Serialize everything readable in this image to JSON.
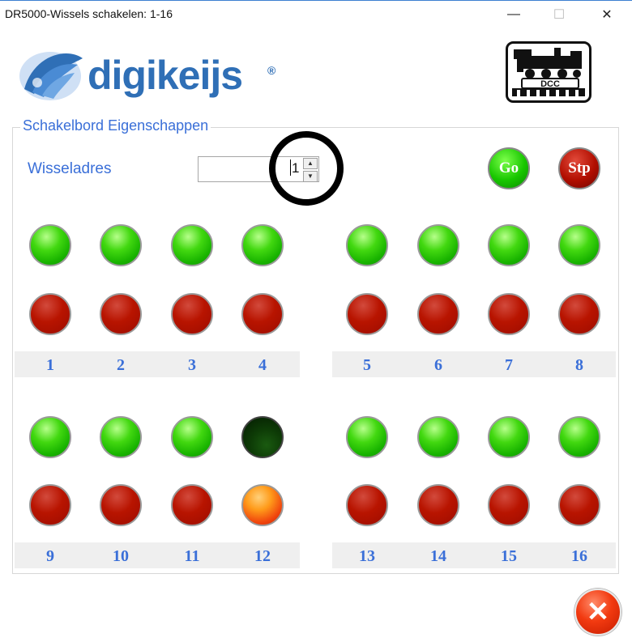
{
  "window": {
    "title": "DR5000-Wissels schakelen: 1-16",
    "minimize": "—",
    "maximize": "☐",
    "close": "✕"
  },
  "logo": {
    "text": "digikeijs",
    "reg": "®",
    "dcc_label": "DCC"
  },
  "panel": {
    "title": "Schakelbord Eigenschappen",
    "address_label": "Wisseladres",
    "address_value": "1",
    "go_label": "Go",
    "stop_label": "Stp"
  },
  "switches": [
    {
      "number": "1",
      "green": "normal",
      "red": "normal"
    },
    {
      "number": "2",
      "green": "normal",
      "red": "normal"
    },
    {
      "number": "3",
      "green": "normal",
      "red": "normal"
    },
    {
      "number": "4",
      "green": "normal",
      "red": "normal"
    },
    {
      "number": "5",
      "green": "normal",
      "red": "normal"
    },
    {
      "number": "6",
      "green": "normal",
      "red": "normal"
    },
    {
      "number": "7",
      "green": "normal",
      "red": "normal"
    },
    {
      "number": "8",
      "green": "normal",
      "red": "normal"
    },
    {
      "number": "9",
      "green": "normal",
      "red": "normal"
    },
    {
      "number": "10",
      "green": "normal",
      "red": "normal"
    },
    {
      "number": "11",
      "green": "normal",
      "red": "normal"
    },
    {
      "number": "12",
      "green": "dark",
      "red": "lit"
    },
    {
      "number": "13",
      "green": "normal",
      "red": "normal"
    },
    {
      "number": "14",
      "green": "normal",
      "red": "normal"
    },
    {
      "number": "15",
      "green": "normal",
      "red": "normal"
    },
    {
      "number": "16",
      "green": "normal",
      "red": "normal"
    }
  ],
  "close_icon": "close-x-icon",
  "colors": {
    "accent": "#3a6fd8",
    "green": "#19b400",
    "red": "#b81400",
    "brand": "#2f6fb6"
  }
}
